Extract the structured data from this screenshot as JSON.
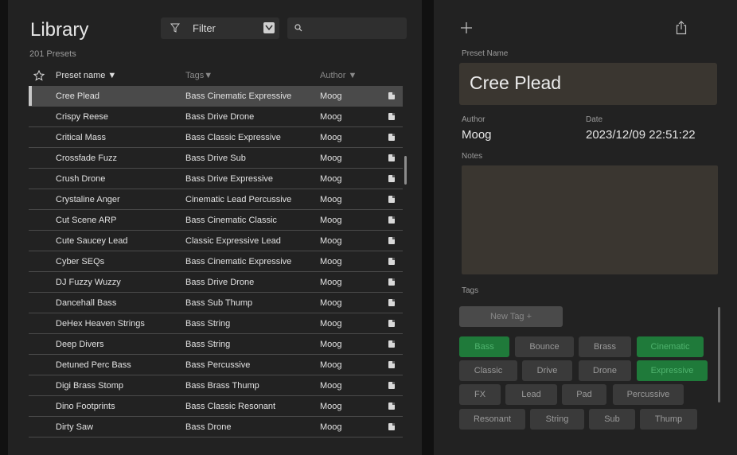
{
  "library": {
    "title": "Library",
    "count_label": "201 Presets",
    "filter_label": "Filter",
    "search_value": "",
    "columns": {
      "name": "Preset name ▼",
      "tags": "Tags▼",
      "author": "Author ▼"
    },
    "rows": [
      {
        "name": "Cree Plead",
        "tags": "Bass Cinematic Expressive",
        "author": "Moog",
        "selected": true
      },
      {
        "name": "Crispy Reese",
        "tags": "Bass Drive Drone",
        "author": "Moog"
      },
      {
        "name": "Critical Mass",
        "tags": "Bass Classic Expressive",
        "author": "Moog"
      },
      {
        "name": "Crossfade Fuzz",
        "tags": "Bass Drive Sub",
        "author": "Moog"
      },
      {
        "name": "Crush Drone",
        "tags": "Bass Drive Expressive",
        "author": "Moog"
      },
      {
        "name": "Crystaline Anger",
        "tags": "Cinematic Lead Percussive",
        "author": "Moog"
      },
      {
        "name": "Cut Scene ARP",
        "tags": "Bass Cinematic Classic",
        "author": "Moog"
      },
      {
        "name": "Cute Saucey Lead",
        "tags": "Classic Expressive Lead",
        "author": "Moog"
      },
      {
        "name": "Cyber SEQs",
        "tags": "Bass Cinematic Expressive",
        "author": "Moog"
      },
      {
        "name": "DJ Fuzzy Wuzzy",
        "tags": "Bass Drive Drone",
        "author": "Moog"
      },
      {
        "name": "Dancehall Bass",
        "tags": "Bass Sub Thump",
        "author": "Moog"
      },
      {
        "name": "DeHex Heaven Strings",
        "tags": "Bass String",
        "author": "Moog"
      },
      {
        "name": "Deep Divers",
        "tags": "Bass String",
        "author": "Moog"
      },
      {
        "name": "Detuned Perc Bass",
        "tags": "Bass Percussive",
        "author": "Moog"
      },
      {
        "name": "Digi Brass Stomp",
        "tags": "Bass Brass Thump",
        "author": "Moog"
      },
      {
        "name": "Dino Footprints",
        "tags": "Bass Classic Resonant",
        "author": "Moog"
      },
      {
        "name": "Dirty Saw",
        "tags": "Bass Drone",
        "author": "Moog"
      }
    ]
  },
  "detail": {
    "preset_name_label": "Preset Name",
    "preset_name": "Cree Plead",
    "author_label": "Author",
    "author": "Moog",
    "date_label": "Date",
    "date": "2023/12/09 22:51:22",
    "notes_label": "Notes",
    "notes": "",
    "tags_label": "Tags",
    "new_tag_label": "New Tag +",
    "tags": [
      {
        "label": "Bass",
        "active": true
      },
      {
        "label": "Bounce",
        "active": false
      },
      {
        "label": "Brass",
        "active": false
      },
      {
        "label": "Cinematic",
        "active": true
      },
      {
        "label": "Classic",
        "active": false
      },
      {
        "label": "Drive",
        "active": false
      },
      {
        "label": "Drone",
        "active": false
      },
      {
        "label": "Expressive",
        "active": true
      },
      {
        "label": "FX",
        "active": false
      },
      {
        "label": "Lead",
        "active": false
      },
      {
        "label": "Pad",
        "active": false
      },
      {
        "label": "Percussive",
        "active": false
      },
      {
        "label": "Resonant",
        "active": false
      },
      {
        "label": "String",
        "active": false
      },
      {
        "label": "Sub",
        "active": false
      },
      {
        "label": "Thump",
        "active": false
      }
    ]
  },
  "colors": {
    "accent_green": "#1f7a3a",
    "panel": "#222222",
    "field": "#3a3630"
  }
}
